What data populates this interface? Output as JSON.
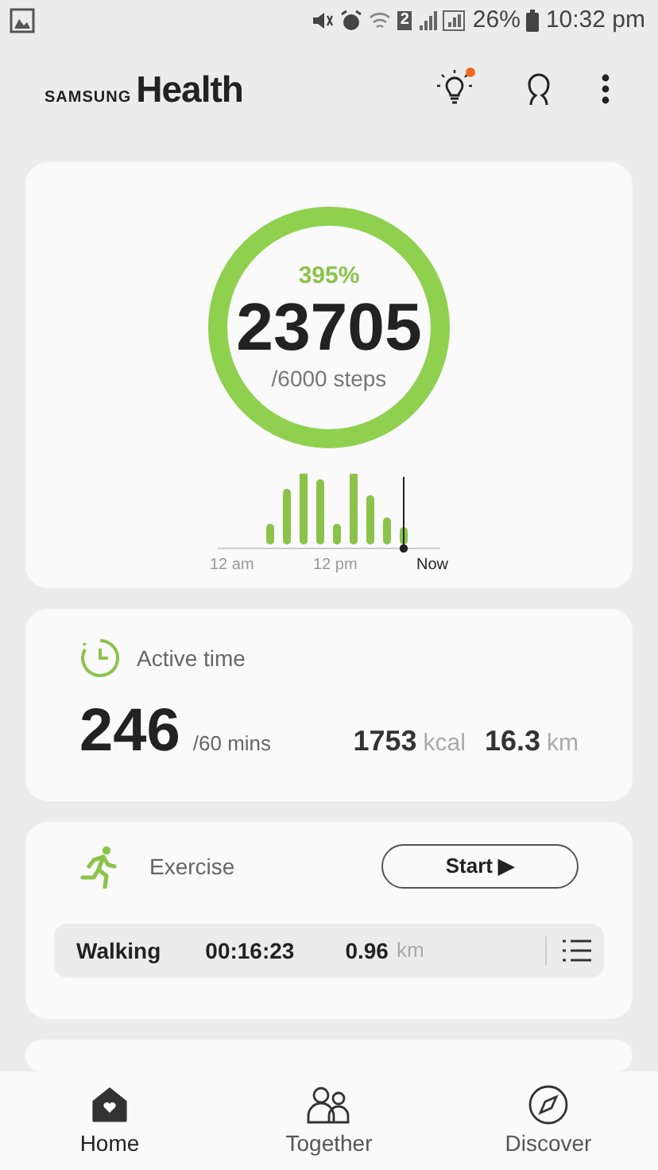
{
  "status_bar": {
    "battery": "26%",
    "time": "10:32 pm",
    "sim_badge": "2"
  },
  "header": {
    "brand_small": "SAMSUNG",
    "brand_large": "Health",
    "tips_unread": true
  },
  "steps": {
    "percent": "395%",
    "count": "23705",
    "goal": "/6000 steps",
    "level": 1,
    "axis_labels": [
      "12 am",
      "12 pm",
      "Now"
    ]
  },
  "active_time": {
    "title": "Active time",
    "value": "246",
    "goal": "/60 mins",
    "kcal": "1753",
    "kcal_unit": "kcal",
    "distance": "16.3",
    "distance_unit": "km"
  },
  "exercise": {
    "title": "Exercise",
    "button": "Start ▶",
    "last": {
      "type": "Walking",
      "duration": "00:16:23",
      "distance": "0.96",
      "unit": "km"
    }
  },
  "bottom_nav": [
    {
      "label": "Home",
      "kind": "home",
      "selected": true
    },
    {
      "label": "Together",
      "kind": "together",
      "selected": false
    },
    {
      "label": "Discover",
      "kind": "discover",
      "selected": false
    }
  ]
}
